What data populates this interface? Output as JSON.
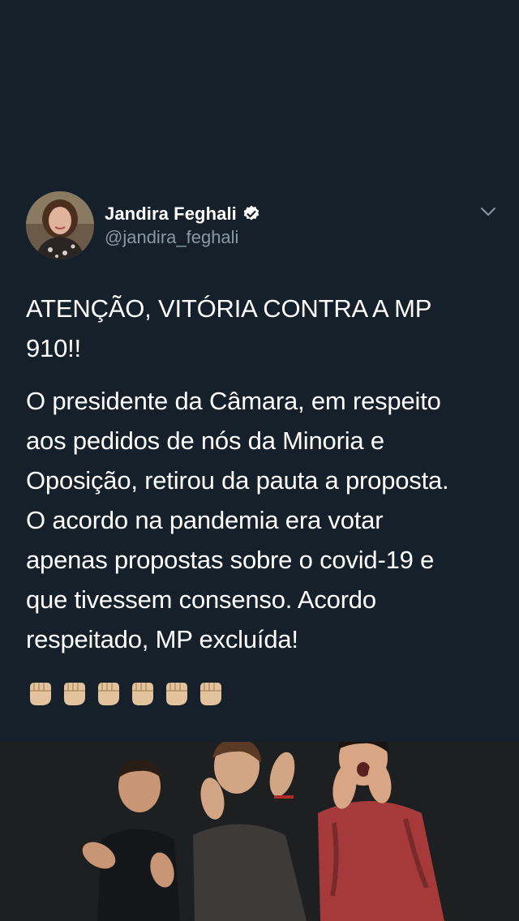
{
  "tweet": {
    "author_name": "Jandira Feghali",
    "handle": "@jandira_feghali",
    "verified": true,
    "headline": "ATENÇÃO, VITÓRIA CONTRA A MP\n910!!",
    "body": "O presidente da Câmara, em respeito\naos pedidos de nós da Minoria e\nOposição, retirou da pauta a proposta.\nO acordo na pandemia era votar\napenas propostas sobre o covid-19 e\nque tivessem consenso. Acordo\nrespeitado, MP excluída!",
    "emoji_row": [
      "raised-fist-icon",
      "raised-fist-icon",
      "raised-fist-icon",
      "raised-fist-icon",
      "raised-fist-icon",
      "raised-fist-icon"
    ]
  },
  "colors": {
    "background": "#15202b",
    "text": "#ffffff",
    "secondary_text": "#8899a6",
    "verified_badge": "#ffffff",
    "gif_background": "#1e1f21"
  },
  "icons": {
    "verified": "verified-badge-icon",
    "menu": "chevron-down-icon"
  },
  "media": {
    "type": "animated-gif",
    "description_icon": "clapping-men-gif"
  }
}
